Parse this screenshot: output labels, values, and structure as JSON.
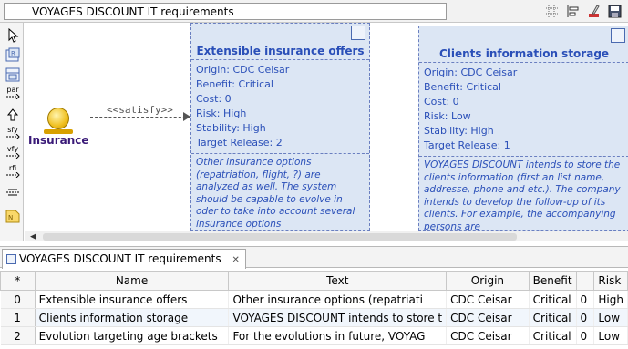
{
  "editor": {
    "title": "VOYAGES DISCOUNT IT requirements"
  },
  "toolbar": {
    "icons": [
      "grid-icon",
      "align-icon",
      "format-brush-icon",
      "save-icon"
    ]
  },
  "palette": {
    "items": [
      {
        "icon": "select-arrow-icon"
      },
      {
        "icon": "requirement-icon"
      },
      {
        "icon": "requirement-group-icon"
      },
      {
        "icon": "par-link-icon",
        "label": "par"
      },
      {
        "icon": "refine-arrow-icon"
      },
      {
        "icon": "sfy-link-icon",
        "label": "sfy"
      },
      {
        "icon": "vfy-link-icon",
        "label": "vfy"
      },
      {
        "icon": "rfi-link-icon",
        "label": "rfi"
      },
      {
        "icon": "link-icon"
      },
      {
        "icon": "note-icon"
      }
    ]
  },
  "diagram": {
    "actor": {
      "name": "Insurance"
    },
    "edge": {
      "label": "<<satisfy>>"
    },
    "requirements": [
      {
        "title": "Extensible insurance offers",
        "props": [
          "Origin: CDC Ceisar",
          "Benefit: Critical",
          "Cost: 0",
          "Risk: High",
          "Stability: High",
          "Target Release: 2"
        ],
        "description": "Other insurance options (repatriation, flight, ?) are analyzed as well. The system should be capable to evolve in oder to take into account several insurance options"
      },
      {
        "title": "Clients information storage",
        "props": [
          "Origin: CDC Ceisar",
          "Benefit: Critical",
          "Cost: 0",
          "Risk: Low",
          "Stability: High",
          "Target Release: 1"
        ],
        "description": "VOYAGES DISCOUNT intends to store the clients information (first an list name, addresse, phone and etc.). The company intends to develop the follow-up of its clients. For example, the accompanying persons are"
      }
    ]
  },
  "panel": {
    "tab_label": "VOYAGES DISCOUNT IT requirements",
    "columns": [
      "*",
      "Name",
      "Text",
      "Origin",
      "Benefit",
      "",
      "Risk"
    ],
    "rows": [
      {
        "idx": "0",
        "name": "Extensible insurance offers",
        "text": "Other insurance options (repatriati",
        "origin": "CDC Ceisar",
        "benefit": "Critical",
        "cost": "0",
        "risk": "High"
      },
      {
        "idx": "1",
        "name": "Clients information storage",
        "text": "VOYAGES DISCOUNT intends to store t",
        "origin": "CDC Ceisar",
        "benefit": "Critical",
        "cost": "0",
        "risk": "Low"
      },
      {
        "idx": "2",
        "name": "Evolution targeting age brackets",
        "text": "For the evolutions in future, VOYAG",
        "origin": "CDC Ceisar",
        "benefit": "Critical",
        "cost": "0",
        "risk": "Low"
      }
    ]
  }
}
